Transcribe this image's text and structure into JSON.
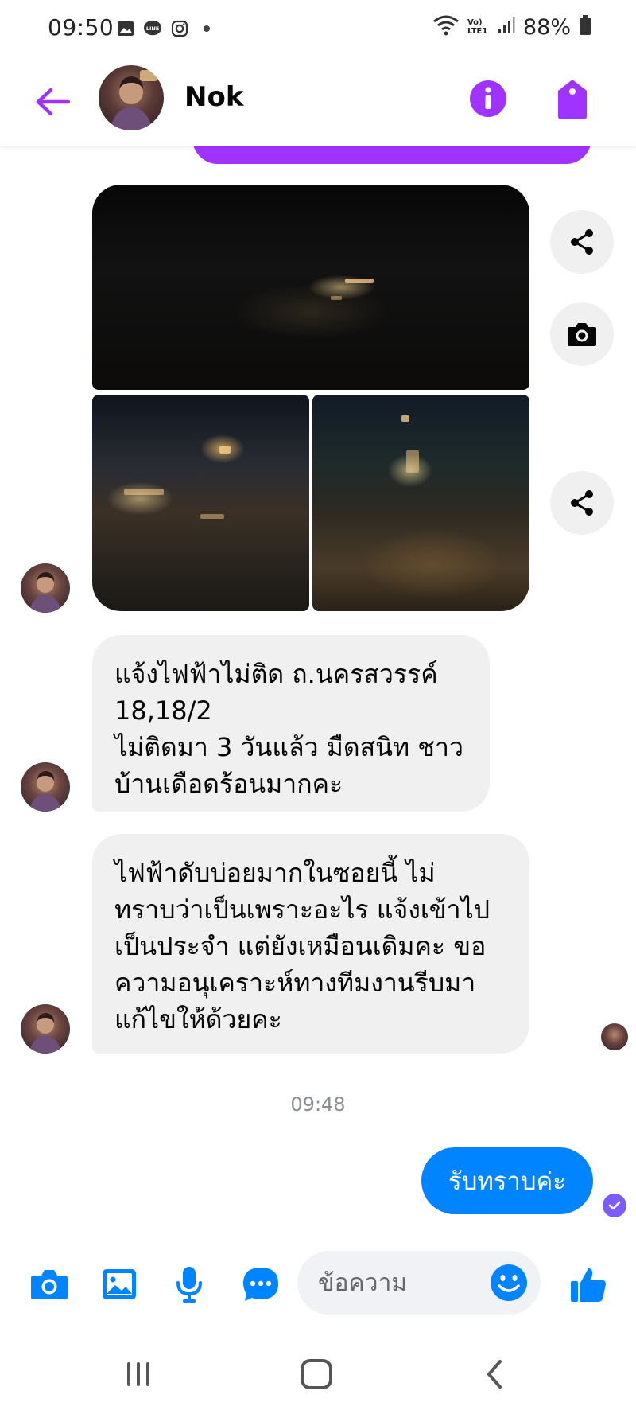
{
  "status_bar": {
    "time": "09:50",
    "network_label": "Vo) LTE1",
    "battery": "88%"
  },
  "header": {
    "contact_name": "Nok",
    "icons": [
      "back-arrow-icon",
      "info-icon",
      "tag-icon"
    ],
    "accent_color": "#a033ff"
  },
  "messages": {
    "received_text_1": [
      "แจ้งไฟฟ้าไม่ติด ถ.นครสวรรค์",
      "18,18/2",
      "ไม่ติดมา 3 วันแล้ว มืดสนิท ชาว",
      "บ้านเดือดร้อนมากคะ"
    ],
    "received_text_2": [
      "ไฟฟ้าดับบ่อยมากในซอยนี้ ไม่",
      "ทราบว่าเป็นเพราะอะไร แจ้งเข้าไป",
      "เป็นประจำ แต่ยังเหมือนเดิมคะ ขอ",
      "ความอนุเคราะห์ทางทีมงานรีบมา",
      "แก้ไขให้ด้วยคะ"
    ],
    "timestamp": "09:48",
    "sent_text": "รับทราบค่ะ",
    "sent_bubble_color": "#0084ff"
  },
  "composer": {
    "placeholder": "ข้อความ",
    "icons": [
      "camera-icon",
      "gallery-icon",
      "microphone-icon",
      "chat-more-icon",
      "emoji-icon",
      "thumbs-up-icon"
    ]
  },
  "navbar": {
    "icons": [
      "recent-apps-icon",
      "home-icon",
      "back-icon"
    ]
  }
}
